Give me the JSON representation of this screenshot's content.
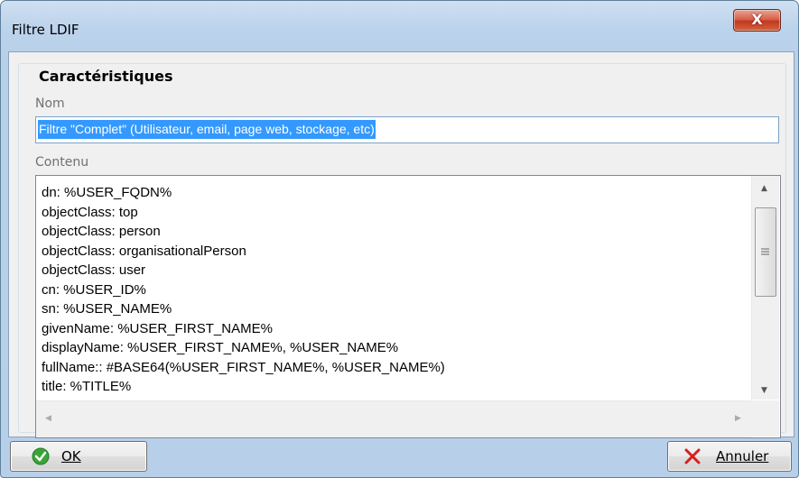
{
  "window": {
    "title": "Filtre LDIF",
    "close_label": "X"
  },
  "group": {
    "legend": "Caractéristiques"
  },
  "name_field": {
    "label": "Nom",
    "value": "Filtre \"Complet\" (Utilisateur, email, page web, stockage, etc)"
  },
  "content_field": {
    "label": "Contenu",
    "lines": [
      "dn: %USER_FQDN%",
      "objectClass: top",
      "objectClass: person",
      "objectClass: organisationalPerson",
      "objectClass: user",
      "cn: %USER_ID%",
      "sn: %USER_NAME%",
      "givenName: %USER_FIRST_NAME%",
      "displayName: %USER_FIRST_NAME%, %USER_NAME%",
      "fullName:: #BASE64(%USER_FIRST_NAME%, %USER_NAME%)",
      "title: %TITLE%"
    ]
  },
  "buttons": {
    "ok": "OK",
    "cancel": "Annuler"
  },
  "icons": {
    "ok": "check-circle-icon",
    "cancel": "red-x-icon"
  },
  "colors": {
    "selection": "#3399ff",
    "ok_icon": "#3aa536",
    "cancel_icon": "#d62020",
    "close_button": "#c9452b"
  }
}
